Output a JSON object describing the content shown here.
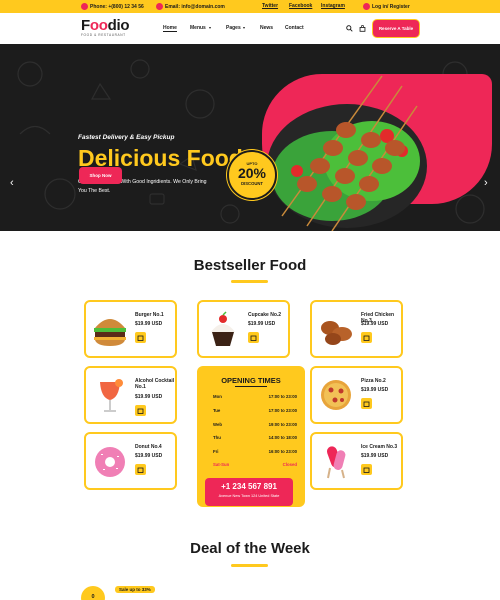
{
  "topbar": {
    "phone": "Phone: +(800) 12 34 56",
    "email": "Email: info@domain.com",
    "twitter": "Twitter",
    "facebook": "Facebook",
    "instagram": "Instagram",
    "login": "Log in/ Register"
  },
  "header": {
    "logo_pre": "F",
    "logo_o": "oo",
    "logo_post": "dio",
    "logo_sub": "FOOD & RESTAURANT",
    "nav": [
      "Home",
      "Menus",
      "Pages",
      "News",
      "Contact"
    ],
    "reserve": "Reserve A Table"
  },
  "hero": {
    "subtitle": "Fastest Delivery & Easy Pickup",
    "title": "Delicious Food",
    "description": "Good Food Starts With Good Ingridients. We Only Bring You The Best.",
    "button": "Shop Now",
    "badge_top": "UPTO",
    "badge_value": "20%",
    "badge_bottom": "DISCOUNT"
  },
  "bestseller": {
    "title": "Bestseller Food",
    "items": [
      {
        "name": "Burger No.1",
        "price": "$19.99 USD"
      },
      {
        "name": "Cupcake No.2",
        "price": "$19.99 USD"
      },
      {
        "name": "Fried Chicken No.3",
        "price": "$19.99 USD"
      },
      {
        "name": "Alcohol Cocktail No.1",
        "price": "$19.99 USD"
      },
      {
        "name": "Pizza No.2",
        "price": "$19.99 USD"
      },
      {
        "name": "Donut No.4",
        "price": "$19.99 USD"
      },
      {
        "name": "Ice Cream No.3",
        "price": "$19.99 USD"
      }
    ]
  },
  "hours": {
    "title": "OPENING TIMES",
    "rows": [
      {
        "day": "Mon",
        "time": "17:00 to 23:00"
      },
      {
        "day": "Tue",
        "time": "17:00 to 23:00"
      },
      {
        "day": "Web",
        "time": "19:00 to 23:00"
      },
      {
        "day": "Thu",
        "time": "14:00 to 18:00"
      },
      {
        "day": "Fri",
        "time": "16:00 to 23:00"
      },
      {
        "day": "Sat-Sun",
        "time": "Closed"
      }
    ],
    "phone": "+1 234 567 891",
    "address": "Avenue New Town 124 United State"
  },
  "deal": {
    "title": "Deal of the Week",
    "sale": "Sale up to 33%",
    "counter": "0"
  },
  "colors": {
    "yellow": "#ffc91e",
    "pink": "#ee2757",
    "dark": "#1c1c1c"
  }
}
